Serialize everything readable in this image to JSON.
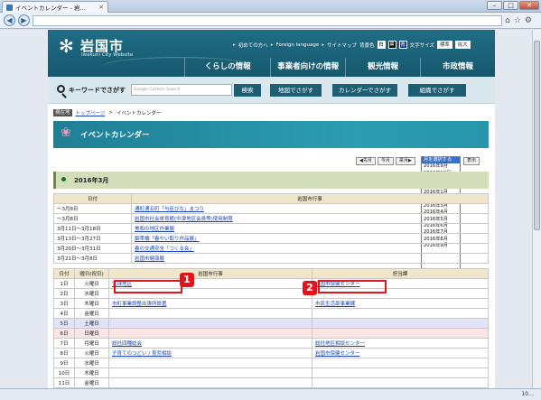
{
  "browser": {
    "tab_title": "イベントカレンダー - 岩…",
    "tab_close": "×",
    "address": "",
    "zoom": "10…"
  },
  "header": {
    "logo_mark": "✻",
    "logo_name": "岩国市",
    "logo_en": "Iwakuni City Website",
    "util_links": [
      "初めての方へ",
      "Foreign language",
      "サイトマップ"
    ],
    "color_label": "背景色",
    "colors": [
      {
        "label": "白",
        "hex": "#ffffff"
      },
      {
        "label": "黒",
        "hex": "#000000"
      },
      {
        "label": "青",
        "hex": "#1038a8"
      }
    ],
    "size_label": "文字サイズ",
    "size_buttons": [
      "標準",
      "拡大"
    ],
    "main_nav": [
      "くらしの情報",
      "事業者向けの情報",
      "観光情報",
      "市政情報"
    ]
  },
  "search": {
    "label": "キーワードでさがす",
    "placeholder": "Google Custom Search",
    "button": "検索",
    "buttons": [
      "地図でさがす",
      "カレンダーでさがす",
      "組織でさがす"
    ]
  },
  "breadcrumb": {
    "here": "現在地",
    "home": "トップページ",
    "sep": ">",
    "current": "イベントカレンダー"
  },
  "banner": {
    "icon": "❀",
    "title": "イベントカレンダー"
  },
  "month_nav": {
    "prev": "◀先月",
    "this": "今月",
    "next": "来月▶",
    "show": "表示",
    "options": [
      "月を選択する",
      "2016年9月",
      "2016年10月",
      "2016年11月",
      "2016年12月",
      "2016年1月",
      "2016年2月",
      "2016年3月",
      "2016年4月",
      "2016年5月",
      "2016年6月",
      "2016年7月",
      "2016年8月",
      "2016年9月"
    ]
  },
  "month": {
    "title": "2016年3月"
  },
  "table1": {
    "headers": [
      "日付",
      "岩国市行事"
    ],
    "rows": [
      [
        "～3月8日",
        "通町通五町「与臣びな」まつり"
      ],
      [
        "～3月8日",
        "岩国市社会体育館(中津地区会員等)使用制限"
      ],
      [
        "3月11日～3月18日",
        "美和の地区作業展"
      ],
      [
        "3月13日～3月27日",
        "錦帯橋「春やい取り作品展」"
      ],
      [
        "3月20日～3月31日",
        "春の交通安全「つくる会」"
      ],
      [
        "3月21日～3月8日",
        "岩国市健康展"
      ]
    ]
  },
  "table2": {
    "headers": [
      "日付",
      "曜日(祝日)",
      "岩国市行事",
      "担当課"
    ],
    "rows": [
      {
        "d": "1日",
        "w": "火曜日",
        "e": "宮球地区",
        "c": "岩国市保健センター",
        "k": ""
      },
      {
        "d": "2日",
        "w": "水曜日",
        "e": "",
        "c": "",
        "k": ""
      },
      {
        "d": "3日",
        "w": "木曜日",
        "e": "市町事業調整出張所設置",
        "c": "市民生活部事業課",
        "k": ""
      },
      {
        "d": "4日",
        "w": "金曜日",
        "e": "",
        "c": "",
        "k": ""
      },
      {
        "d": "5日",
        "w": "土曜日",
        "e": "",
        "c": "",
        "k": "sat"
      },
      {
        "d": "6日",
        "w": "日曜日",
        "e": "",
        "c": "",
        "k": "sun"
      },
      {
        "d": "7日",
        "w": "月曜日",
        "e": "総社四種総会",
        "c": "総社地区相談センター",
        "k": ""
      },
      {
        "d": "8日",
        "w": "火曜日",
        "e": "子育てのつどい / 育児相談",
        "c": "岩国市保健センター",
        "k": ""
      },
      {
        "d": "9日",
        "w": "水曜日",
        "e": "",
        "c": "",
        "k": ""
      },
      {
        "d": "10日",
        "w": "木曜日",
        "e": "",
        "c": "",
        "k": ""
      },
      {
        "d": "11日",
        "w": "金曜日",
        "e": "",
        "c": "",
        "k": ""
      }
    ]
  },
  "callouts": [
    "1",
    "2"
  ],
  "colors": {
    "header": "#1c657b",
    "month_bar": "#d2dfba",
    "highlight": "#e0141a",
    "table_head": "#efe6cb"
  }
}
